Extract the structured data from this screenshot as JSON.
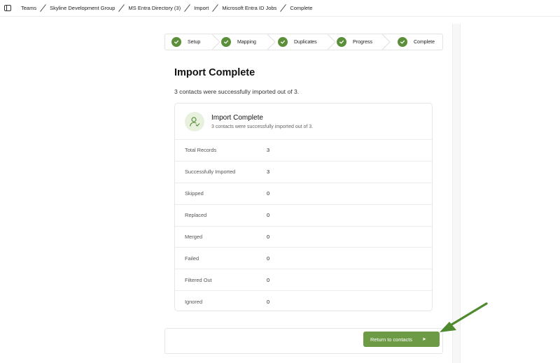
{
  "breadcrumbs": [
    "Teams",
    "Skyline Development Group",
    "MS Entra Directory (3)",
    "Import",
    "Microsoft Entra ID Jobs",
    "Complete"
  ],
  "stepper": [
    {
      "label": "Setup",
      "status": "complete"
    },
    {
      "label": "Mapping",
      "status": "complete"
    },
    {
      "label": "Duplicates",
      "status": "complete"
    },
    {
      "label": "Progress",
      "status": "complete"
    },
    {
      "label": "Complete",
      "status": "complete"
    }
  ],
  "main": {
    "title": "Import Complete",
    "subtitle": "3 contacts were successfully imported out of 3."
  },
  "card": {
    "title": "Import Complete",
    "subtitle": "3 contacts were successfully imported out of 3.",
    "icon": "user-check-icon",
    "rows": [
      {
        "label": "Total Records",
        "value": "3"
      },
      {
        "label": "Successfully Imported",
        "value": "3"
      },
      {
        "label": "Skipped",
        "value": "0"
      },
      {
        "label": "Replaced",
        "value": "0"
      },
      {
        "label": "Merged",
        "value": "0"
      },
      {
        "label": "Failed",
        "value": "0"
      },
      {
        "label": "Filtered Out",
        "value": "0"
      },
      {
        "label": "Ignored",
        "value": "0"
      }
    ]
  },
  "footer": {
    "return_label": "Return to contacts",
    "return_icon": "arrow-right-icon"
  },
  "colors": {
    "accent_green": "#6c9a45",
    "check_green": "#5c8f3a",
    "annotation_arrow": "#4f8a2f"
  }
}
